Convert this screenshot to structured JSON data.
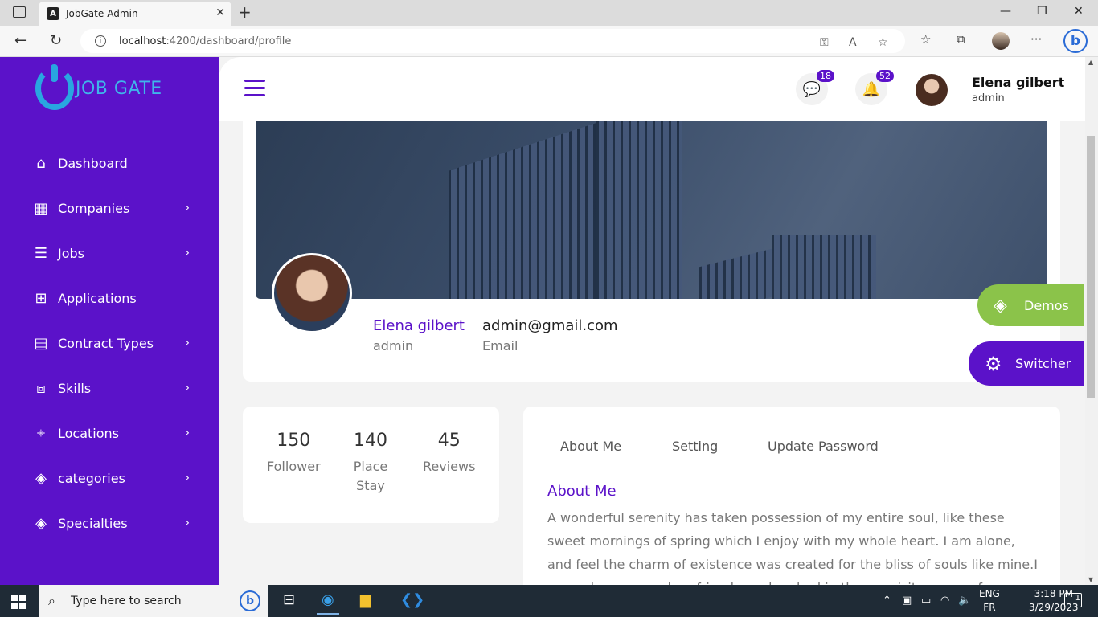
{
  "browser": {
    "tab_title": "JobGate-Admin",
    "url_host": "localhost",
    "url_path": ":4200/dashboard/profile"
  },
  "sidebar": {
    "logo_text": "JOB GATE",
    "items": [
      {
        "label": "Dashboard",
        "icon": "home-icon",
        "chevron": false
      },
      {
        "label": "Companies",
        "icon": "building-icon",
        "chevron": true
      },
      {
        "label": "Jobs",
        "icon": "list-icon",
        "chevron": true
      },
      {
        "label": "Applications",
        "icon": "apps-icon",
        "chevron": false
      },
      {
        "label": "Contract Types",
        "icon": "document-icon",
        "chevron": true
      },
      {
        "label": "Skills",
        "icon": "puzzle-icon",
        "chevron": true
      },
      {
        "label": "Locations",
        "icon": "location-icon",
        "chevron": true
      },
      {
        "label": "categories",
        "icon": "layers-icon",
        "chevron": true
      },
      {
        "label": "Specialties",
        "icon": "layers-icon",
        "chevron": true
      }
    ]
  },
  "header": {
    "messages_count": "18",
    "notifications_count": "52",
    "user_name": "Elena gilbert",
    "user_role": "admin"
  },
  "profile": {
    "name": "Elena gilbert",
    "role": "admin",
    "email": "admin@gmail.com",
    "email_label": "Email"
  },
  "floating": {
    "demos_label": "Demos",
    "switcher_label": "Switcher"
  },
  "stats": [
    {
      "value": "150",
      "label": "Follower"
    },
    {
      "value": "140",
      "label": "Place Stay"
    },
    {
      "value": "45",
      "label": "Reviews"
    }
  ],
  "about": {
    "tabs": [
      "About Me",
      "Setting",
      "Update Password"
    ],
    "title": "About Me",
    "text": "A wonderful serenity has taken possession of my entire soul, like these sweet mornings of spring which I enjoy with my whole heart. I am alone, and feel the charm of existence was created for the bliss of souls like mine.I am so happy, my dear friend, so absorbed in the exquisite sense of mere"
  },
  "taskbar": {
    "search_placeholder": "Type here to search",
    "lang_top": "ENG",
    "lang_bottom": "FR",
    "time": "3:18 PM",
    "date": "3/29/2023",
    "notification_count": "1"
  }
}
